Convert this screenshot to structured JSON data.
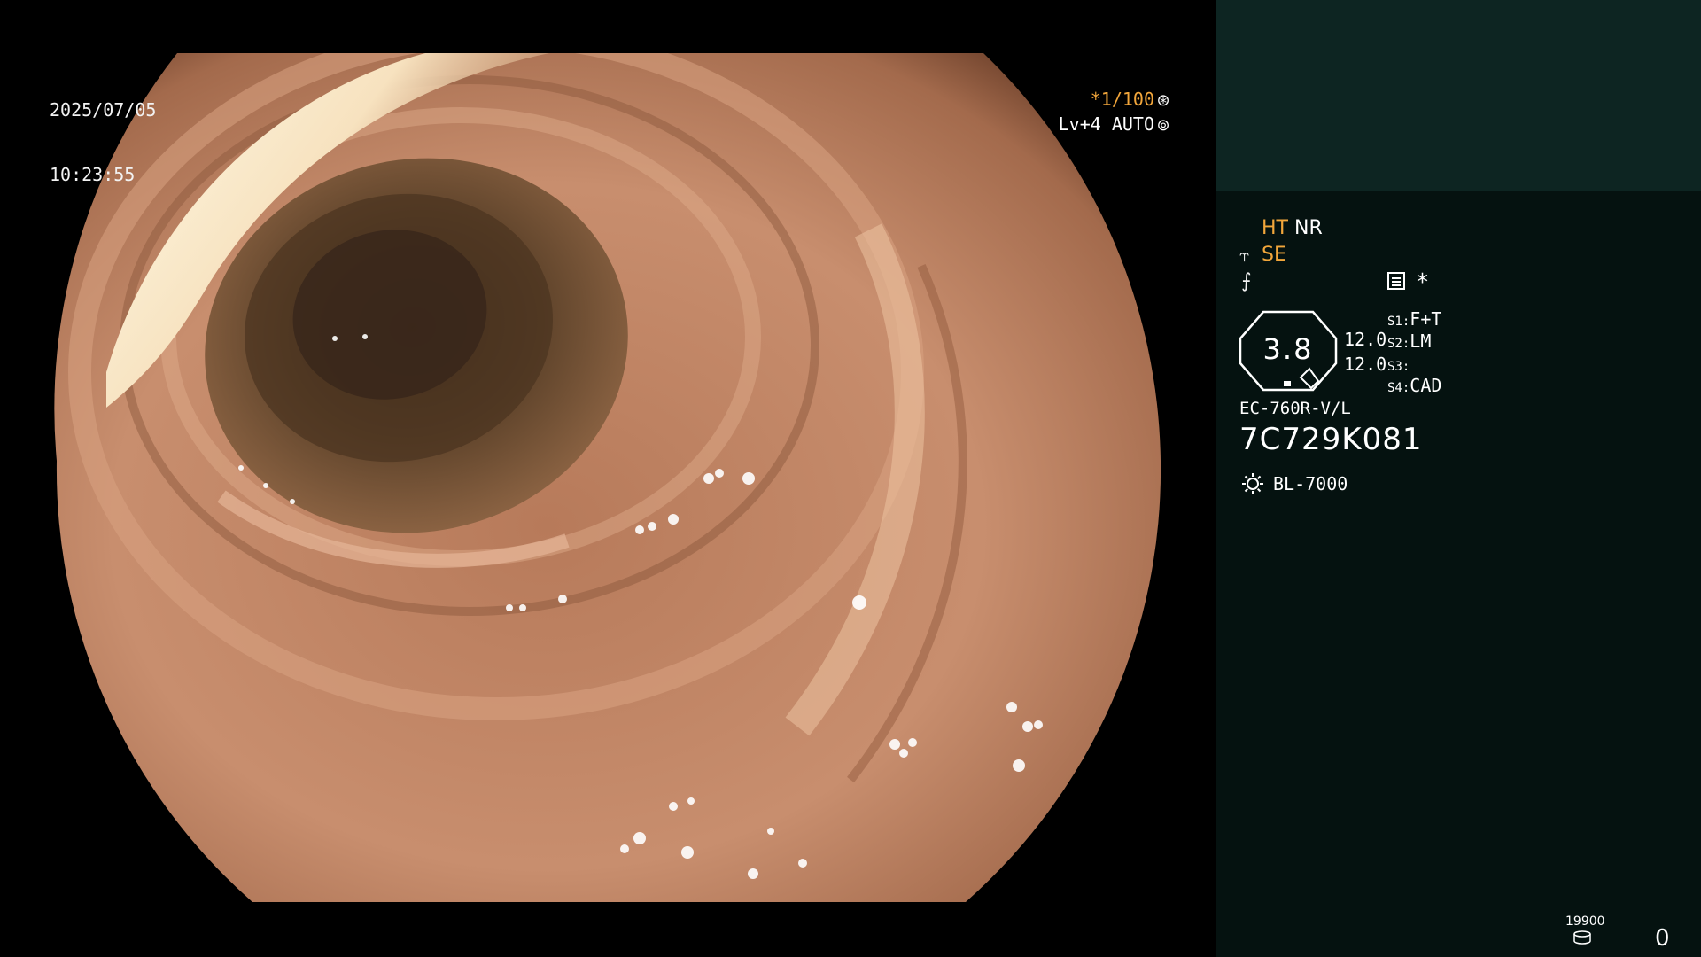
{
  "overlay": {
    "date": "2025/07/05",
    "time": "10:23:55",
    "shutter": "*1/100",
    "shutter_icon": "aperture-icon",
    "level": "Lv+4 AUTO",
    "level_icon": "iris-icon"
  },
  "panel": {
    "ht": "HT",
    "nr": "NR",
    "se_icon_glyph": "⥾",
    "se": "SE",
    "filter_icon_glyph": "⨍",
    "memo_icon": "memo-icon",
    "star": "*",
    "zoom_value": "3.8",
    "value_a": "12.0",
    "value_b": "12.0",
    "s1_label": "S1:",
    "s1_value": "F+T",
    "s2_label": "S2:",
    "s2_value": "LM",
    "s3_label": "S3:",
    "s3_value": "",
    "s4_label": "S4:",
    "s4_value": "CAD",
    "scope_model": "EC-760R-V/L",
    "serial": "7C729K081",
    "light_icon": "light-source-icon",
    "light_source": "BL-7000",
    "counter_small": "19900",
    "counter_icon": "disk-icon",
    "counter_big": "0"
  },
  "colors": {
    "accent_orange": "#f2a63b",
    "panel_bg": "#051210",
    "thumb_bg": "#0d2522",
    "text": "#ffffff"
  }
}
